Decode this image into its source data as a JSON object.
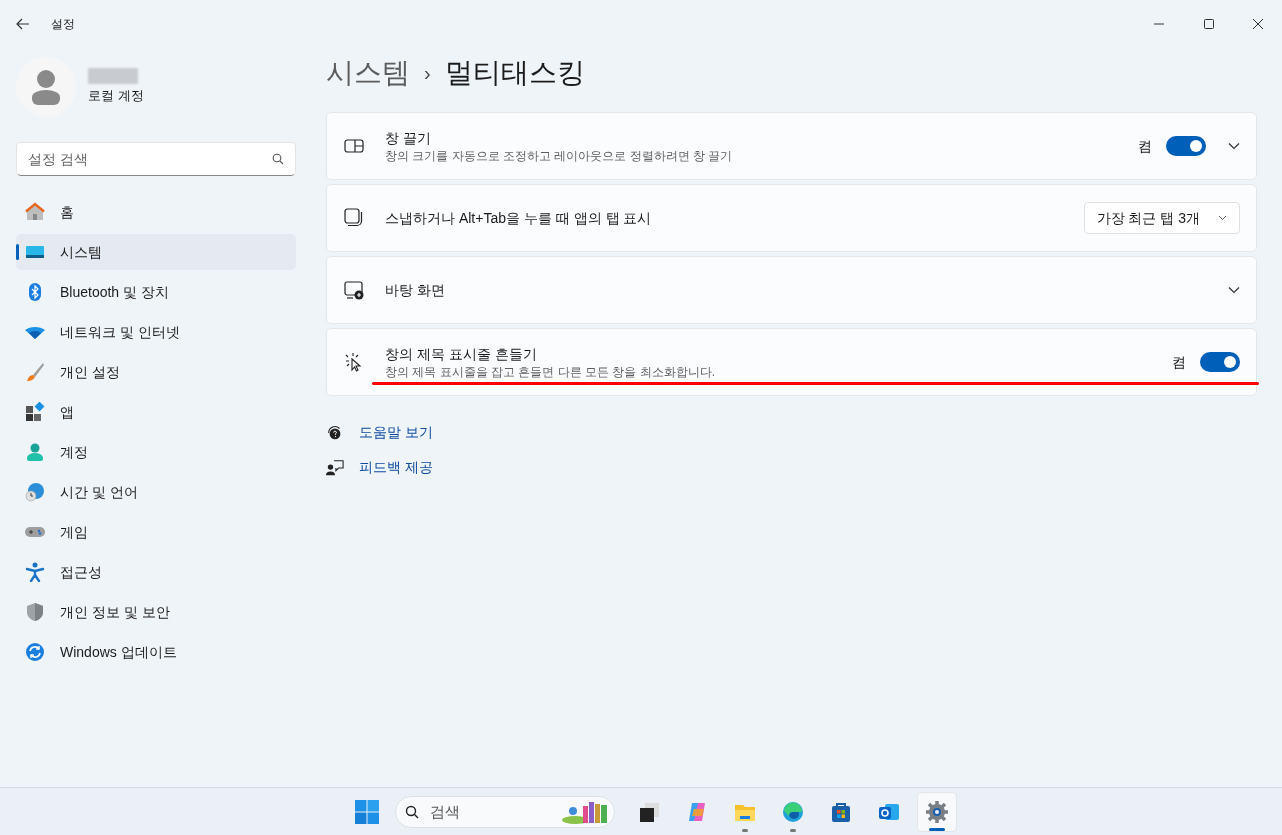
{
  "window": {
    "title": "설정"
  },
  "account": {
    "type": "로컬 계정"
  },
  "search": {
    "placeholder": "설정 검색"
  },
  "sidebar": {
    "items": [
      {
        "label": "홈",
        "selected": false
      },
      {
        "label": "시스템",
        "selected": true
      },
      {
        "label": "Bluetooth 및 장치",
        "selected": false
      },
      {
        "label": "네트워크 및 인터넷",
        "selected": false
      },
      {
        "label": "개인 설정",
        "selected": false
      },
      {
        "label": "앱",
        "selected": false
      },
      {
        "label": "계정",
        "selected": false
      },
      {
        "label": "시간 및 언어",
        "selected": false
      },
      {
        "label": "게임",
        "selected": false
      },
      {
        "label": "접근성",
        "selected": false
      },
      {
        "label": "개인 정보 및 보안",
        "selected": false
      },
      {
        "label": "Windows 업데이트",
        "selected": false
      }
    ]
  },
  "breadcrumb": {
    "parent": "시스템",
    "separator": "›",
    "current": "멀티태스킹"
  },
  "cards": [
    {
      "kind": "toggle",
      "title": "창 끌기",
      "description": "창의 크기를 자동으로 조정하고 레이아웃으로 정렬하려면 창 끌기",
      "toggle_label": "켬",
      "on": true,
      "expandable": true
    },
    {
      "kind": "dropdown",
      "title": "스냅하거나 Alt+Tab을 누를 때 앱의 탭 표시",
      "value": "가장 최근 탭 3개"
    },
    {
      "kind": "expand",
      "title": "바탕 화면",
      "expandable": true
    },
    {
      "kind": "toggle",
      "title": "창의 제목 표시줄 흔들기",
      "description": "창의 제목 표시줄을 잡고 흔들면 다른 모든 창을 최소화합니다.",
      "toggle_label": "켬",
      "on": true,
      "expandable": false
    }
  ],
  "links": [
    {
      "label": "도움말 보기"
    },
    {
      "label": "피드백 제공"
    }
  ],
  "taskbar": {
    "search_placeholder": "검색",
    "apps": [
      {
        "running": false,
        "active": false
      },
      {
        "running": false,
        "active": false
      },
      {
        "running": true,
        "active": false
      },
      {
        "running": true,
        "active": false
      },
      {
        "running": false,
        "active": false
      },
      {
        "running": false,
        "active": false
      },
      {
        "running": true,
        "active": true
      }
    ]
  }
}
